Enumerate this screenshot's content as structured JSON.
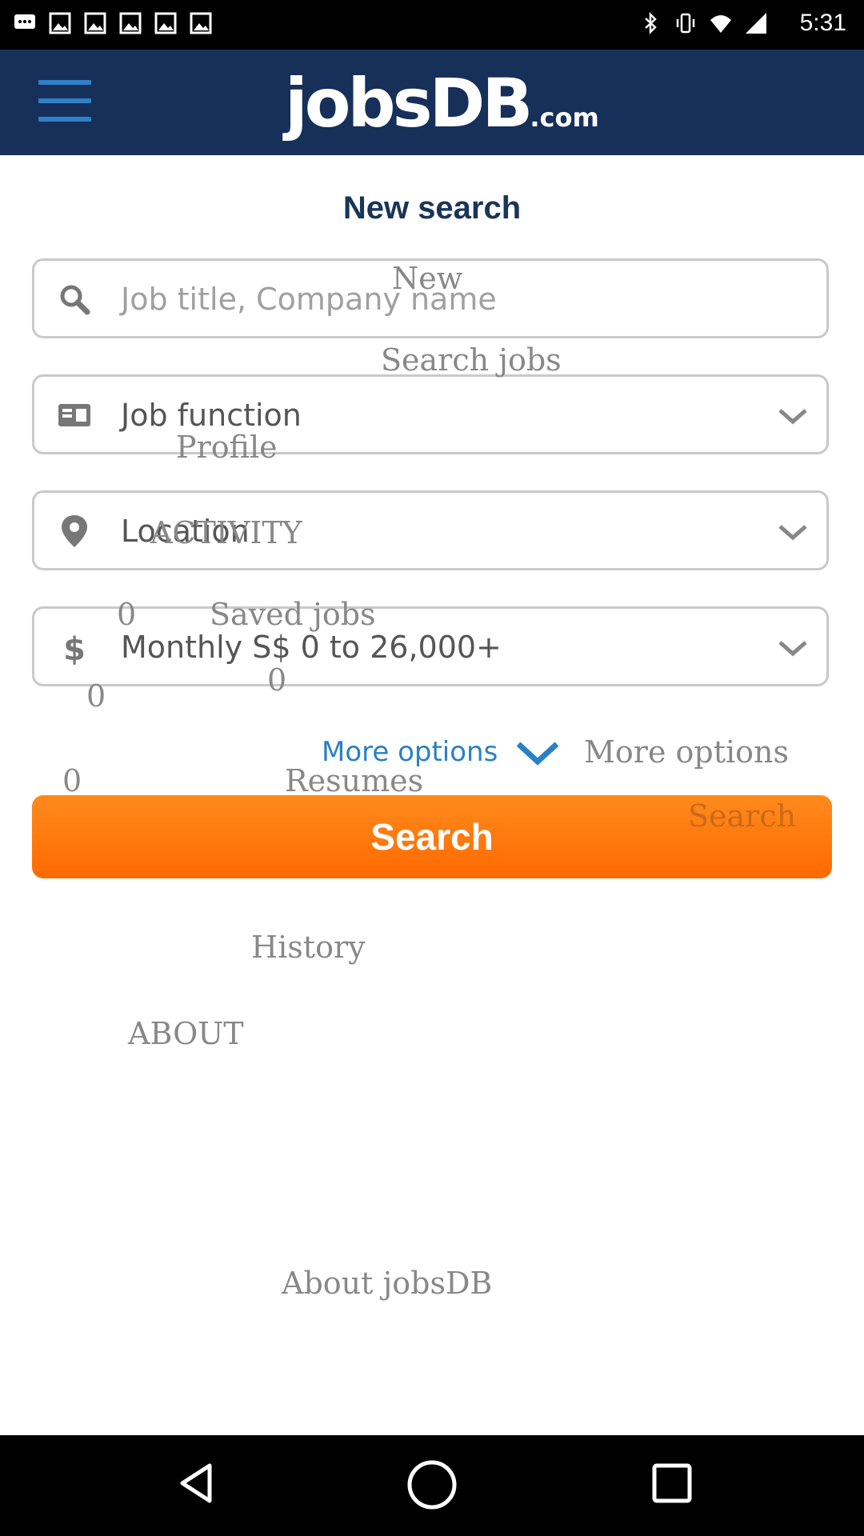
{
  "status_bar": {
    "time": "5:31",
    "icons_left": [
      "chat-icon",
      "image-icon",
      "image-icon",
      "image-icon",
      "image-icon",
      "image-icon"
    ],
    "icons_right": [
      "bluetooth-icon",
      "vibrate-icon",
      "wifi-icon",
      "signal-icon"
    ]
  },
  "app_bar": {
    "logo_main": "jobsDB",
    "logo_suffix": ".com",
    "menu_icon": "hamburger-menu-icon",
    "background": "#16305a"
  },
  "page": {
    "title": "New search"
  },
  "fields": {
    "keyword": {
      "placeholder": "Job title, Company name",
      "icon": "search-icon"
    },
    "job_function": {
      "value": "Job function",
      "icon": "id-card-icon"
    },
    "location": {
      "value": "Location",
      "icon": "map-pin-icon"
    },
    "salary": {
      "value": "Monthly S$ 0 to 26,000+",
      "icon": "dollar-icon"
    }
  },
  "more_options": {
    "label": "More options"
  },
  "search_button": {
    "label": "Search",
    "color": "#ff7a10"
  },
  "overlay_text": {
    "new": "New",
    "search_jobs": "Search jobs",
    "profile": "Profile",
    "activity": "ACTIVITY",
    "saved_count": "0",
    "saved_jobs": "Saved jobs",
    "count_b": "0",
    "count_c": "0",
    "more_options": "More options",
    "count_d": "0",
    "resumes": "Resumes",
    "search": "Search",
    "history": "History",
    "about": "ABOUT",
    "about_jobsdb": "About jobsDB"
  },
  "nav_bar": {
    "icons": [
      "back-icon",
      "home-icon",
      "recent-apps-icon"
    ]
  }
}
